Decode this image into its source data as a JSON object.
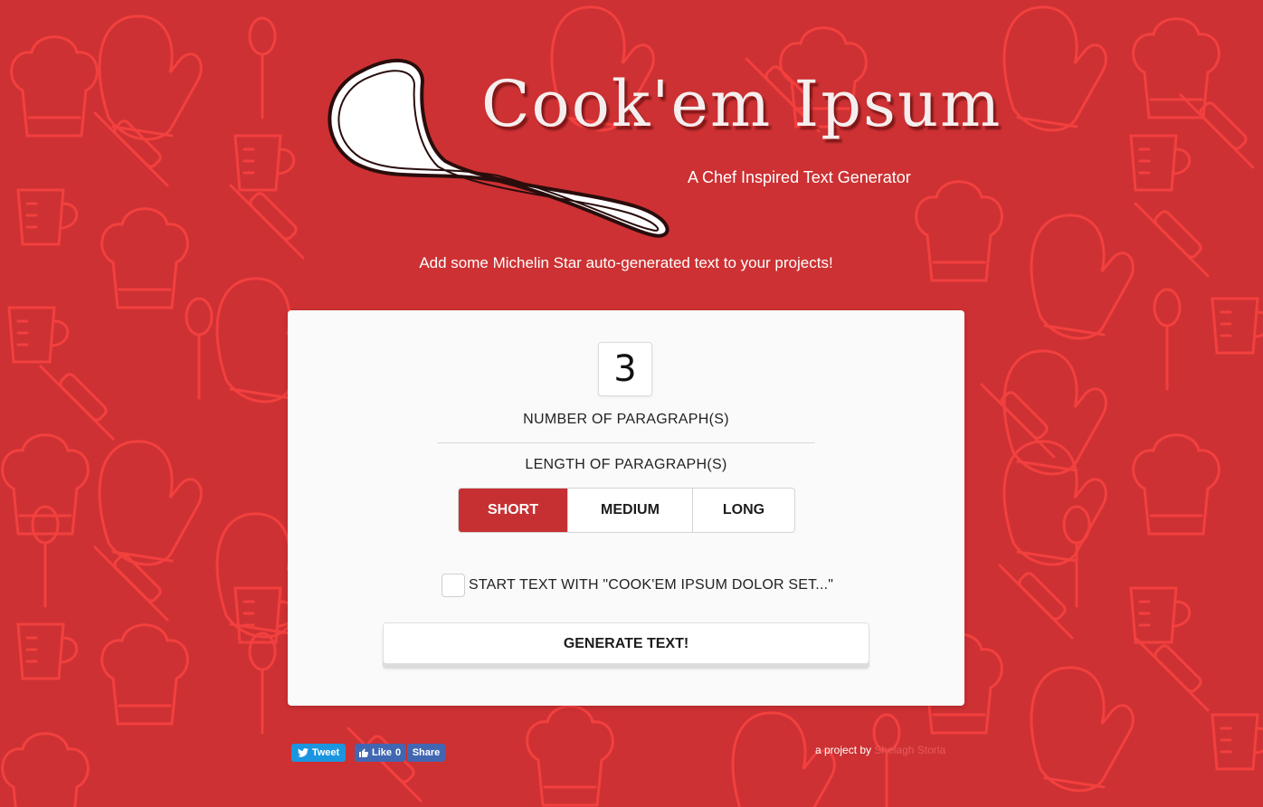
{
  "header": {
    "logo_title": "Cook'em Ipsum",
    "tagline": "A Chef Inspired Text Generator",
    "intro": "Add some Michelin Star auto-generated text to your projects!"
  },
  "form": {
    "paragraph_count": "3",
    "paragraph_count_label": "NUMBER OF PARAGRAPH(S)",
    "length_label": "LENGTH OF PARAGRAPH(S)",
    "length_options": [
      {
        "label": "SHORT",
        "selected": true
      },
      {
        "label": "MEDIUM",
        "selected": false
      },
      {
        "label": "LONG",
        "selected": false
      }
    ],
    "start_text_label": "START TEXT WITH \"COOK'EM IPSUM DOLOR SET...\"",
    "start_text_checked": false,
    "generate_label": "GENERATE TEXT!"
  },
  "footer": {
    "tweet_label": "Tweet",
    "like_label": "Like",
    "like_count": "0",
    "share_label": "Share",
    "credit_prefix": "a project by",
    "credit_name": "Shelagh Storla"
  },
  "colors": {
    "background": "#cd3133",
    "pattern": "#f03a3c",
    "accent": "#c63032",
    "card": "#fafafa",
    "twitter": "#1b95e0",
    "facebook": "#4267b2"
  },
  "icons": [
    "ladle-icon",
    "twitter-bird-icon",
    "thumbs-up-icon"
  ]
}
